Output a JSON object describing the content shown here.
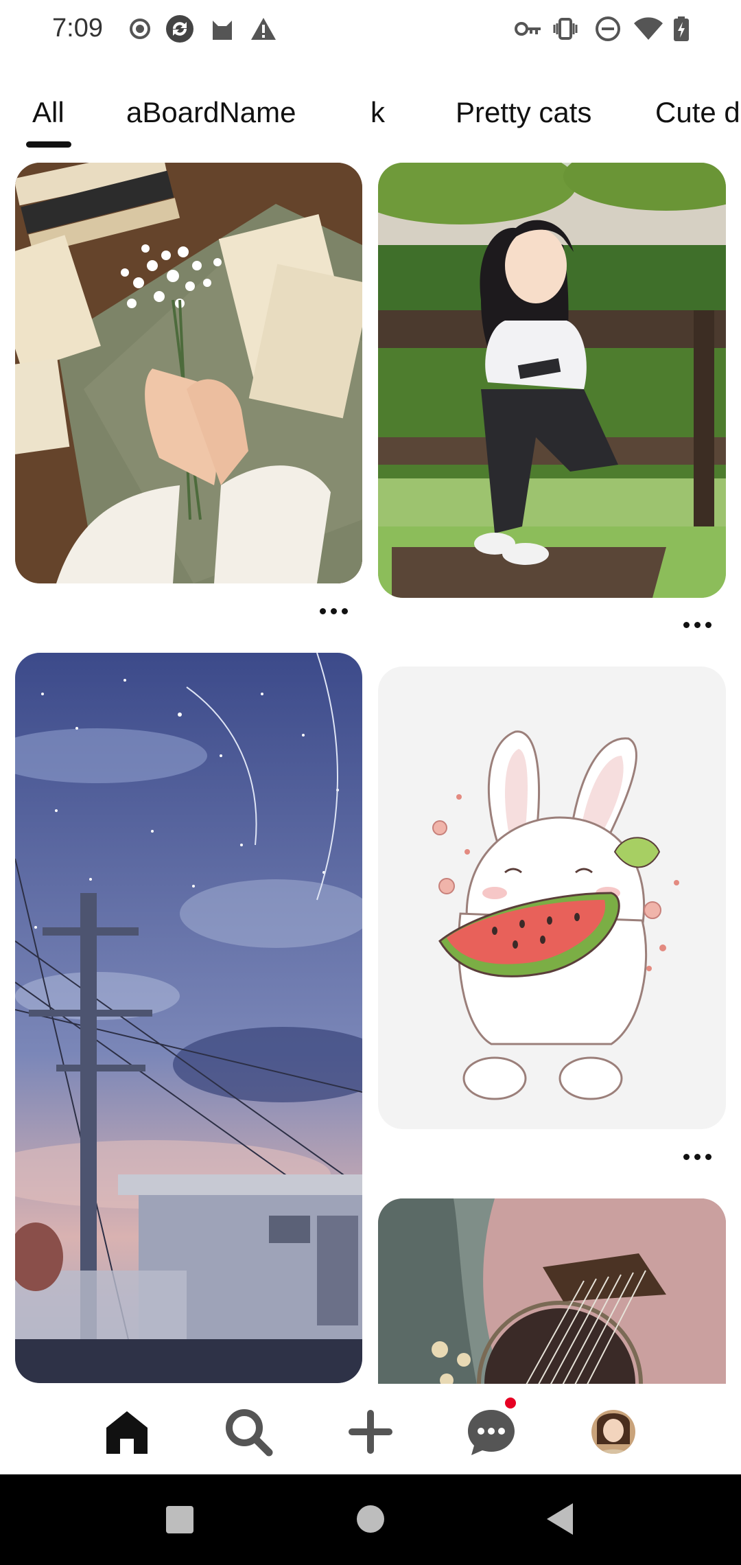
{
  "status_bar": {
    "time": "7:09",
    "left_icons": [
      "record-icon",
      "sync-icon",
      "cat-icon",
      "warning-icon"
    ],
    "right_icons": [
      "vpn-key-icon",
      "vibrate-icon",
      "do-not-disturb-icon",
      "wifi-icon",
      "battery-charging-icon"
    ]
  },
  "board_tabs": [
    {
      "label": "All",
      "selected": true
    },
    {
      "label": "aBoardName",
      "selected": false
    },
    {
      "label": "k",
      "selected": false
    },
    {
      "label": "Pretty cats",
      "selected": false
    },
    {
      "label": "Cute d",
      "selected": false
    }
  ],
  "pins": [
    {
      "subject": "hands holding baby's breath flowers over old books",
      "more": "more-options-icon"
    },
    {
      "subject": "anime girl reading on a park bench",
      "more": "more-options-icon"
    },
    {
      "subject": "starry night sky over train station power lines",
      "more": null
    },
    {
      "subject": "white bunny eating watermelon",
      "more": "more-options-icon"
    },
    {
      "subject": "pink acoustic guitar",
      "more": null
    }
  ],
  "bottom_nav": [
    {
      "name": "home",
      "icon": "home-icon",
      "selected": true
    },
    {
      "name": "search",
      "icon": "search-icon",
      "selected": false
    },
    {
      "name": "create",
      "icon": "plus-icon",
      "selected": false
    },
    {
      "name": "messages",
      "icon": "chat-icon",
      "selected": false,
      "has_notification": true
    },
    {
      "name": "profile",
      "icon": "avatar",
      "selected": false
    }
  ],
  "colors": {
    "accent": "#111111",
    "notification": "#e60023",
    "system_nav_bg": "#000000"
  }
}
